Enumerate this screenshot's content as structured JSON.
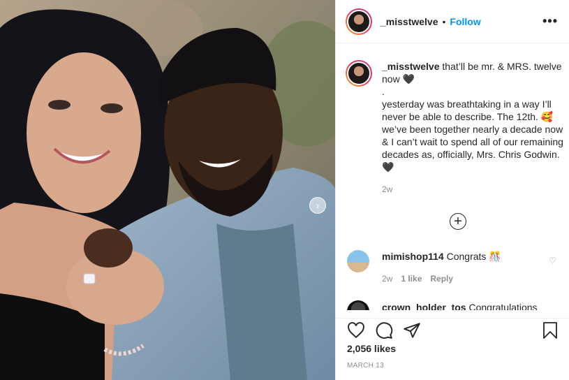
{
  "header": {
    "username": "_misstwelve",
    "separator": "•",
    "follow_label": "Follow",
    "more_label": "•••"
  },
  "caption": {
    "username": "_misstwelve",
    "lines": [
      "that’ll be mr. & MRS. twelve now 🖤",
      ".",
      "yesterday was breathtaking in a way I’ll never be able to describe. The 12th. 🥰 we’ve been together nearly a decade now & I can’t wait to spend all of our remaining decades as, officially, Mrs. Chris Godwin. 🖤"
    ],
    "time": "2w"
  },
  "load_more_icon": "plus-circle-icon",
  "comments": [
    {
      "username": "mimishop114",
      "text": "Congrats 🎊",
      "time": "2w",
      "likes": "1 like",
      "reply": "Reply"
    },
    {
      "username": "crown_holder_tos",
      "text": "Congratulations"
    }
  ],
  "actions": {
    "icons": [
      "heart-icon",
      "comment-icon",
      "share-icon",
      "bookmark-icon"
    ],
    "likes": "2,056 likes",
    "date": "MARCH 13"
  },
  "colors": {
    "link_blue": "#0095f6",
    "text": "#262626",
    "muted": "#8e8e8e",
    "border": "#efefef"
  }
}
